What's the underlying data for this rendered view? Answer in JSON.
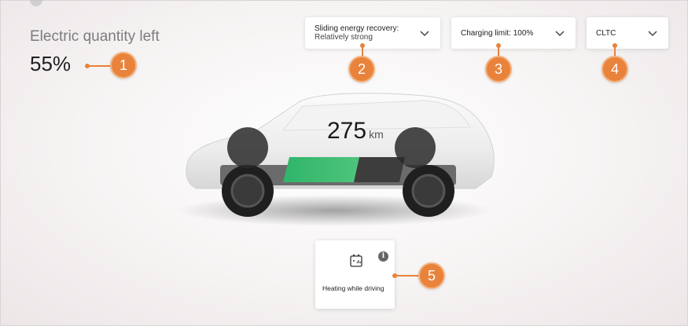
{
  "battery": {
    "label": "Electric quantity left",
    "percent": "55%"
  },
  "dropdowns": {
    "energy_recovery": {
      "label": "Sliding energy recovery:",
      "value": "Relatively strong"
    },
    "charging_limit": {
      "label": "Charging limit:",
      "value": "100%"
    },
    "cycle": {
      "value": "CLTC"
    }
  },
  "range": {
    "value": "275",
    "unit": "km"
  },
  "heating_card": {
    "label": "Heating while driving",
    "icon": "battery-heating-icon"
  },
  "callouts": [
    "1",
    "2",
    "3",
    "4",
    "5"
  ],
  "colors": {
    "accent": "#e9823a",
    "battery_fill": "#33b56e"
  }
}
